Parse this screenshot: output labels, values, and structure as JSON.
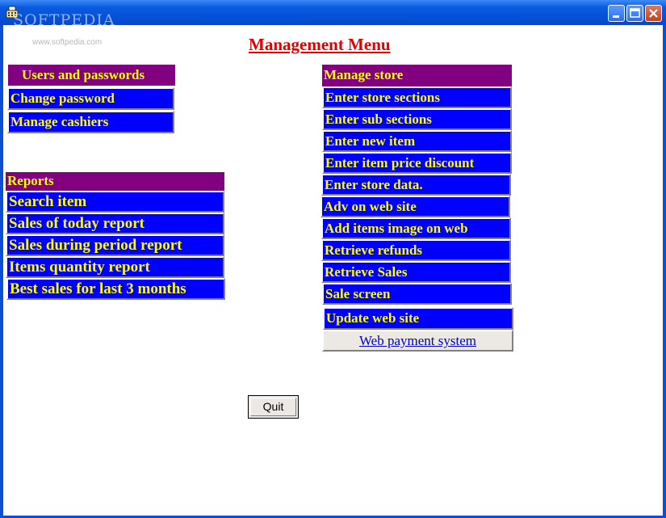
{
  "window": {
    "watermark": "SOFTPEDIA",
    "watermark_url": "www.softpedia.com",
    "controls": [
      "minimize-icon",
      "maximize-icon",
      "close-icon"
    ]
  },
  "page": {
    "title": "Management Menu"
  },
  "users_panel": {
    "header": "Users and passwords",
    "items": [
      "Change password",
      "Manage cashiers"
    ]
  },
  "reports_panel": {
    "header": "Reports",
    "items": [
      "Search item",
      "Sales of today report",
      "Sales during period report",
      "Items quantity report",
      "Best sales for last 3 months"
    ]
  },
  "store_panel": {
    "header": "Manage store",
    "items": [
      "Enter store sections",
      "Enter sub sections",
      "Enter new item",
      "Enter item price discount",
      "Enter store data.",
      "Adv on web site",
      "Add items image on web",
      "Retrieve refunds",
      "Retrieve Sales",
      "Sale screen",
      "Update web site"
    ],
    "web_link": "Web payment system"
  },
  "quit_label": "Quit",
  "colors": {
    "menu_bg": "#0000ff",
    "menu_text": "#ffff00",
    "header_bg": "#800080",
    "title": "#e00000"
  }
}
